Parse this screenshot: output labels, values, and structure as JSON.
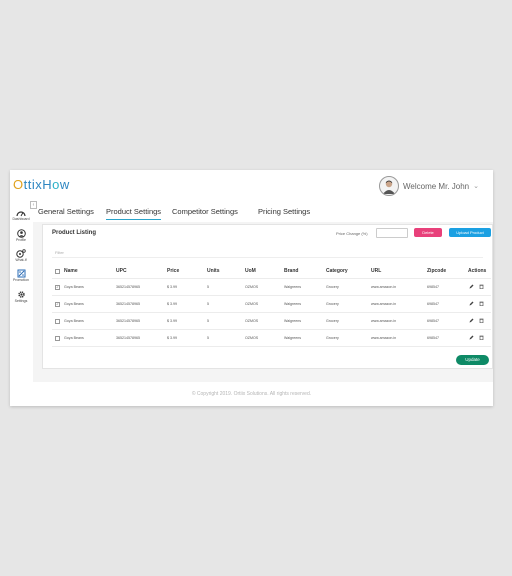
{
  "app": {
    "logo": {
      "part1": "O",
      "part2": "ttixH",
      "part3": "o",
      "part4": "w"
    },
    "welcome": "Welcome Mr. John"
  },
  "sidebar": {
    "items": [
      {
        "label": "Dashboard",
        "icon": "dashboard-icon"
      },
      {
        "label": "Profile",
        "icon": "profile-icon"
      },
      {
        "label": "What-If",
        "icon": "what-if-icon"
      },
      {
        "label": "Promotion",
        "icon": "promotion-icon"
      },
      {
        "label": "Settings",
        "icon": "settings-icon"
      }
    ]
  },
  "tabs": [
    {
      "label": "General Settings"
    },
    {
      "label": "Product Settings",
      "active": true
    },
    {
      "label": "Competitor Settings"
    },
    {
      "label": "Pricing Settings"
    }
  ],
  "panel": {
    "title": "Product Listing",
    "price_change_label": "Price Change (%)",
    "price_change_value": "",
    "delete_label": "Delete",
    "upload_label": "Upload Product",
    "filter_label": "Filter",
    "update_label": "Update"
  },
  "table": {
    "columns": [
      "Name",
      "UPC",
      "Price",
      "Units",
      "UoM",
      "Brand",
      "Category",
      "URL",
      "Zipcode",
      "Actions"
    ],
    "rows": [
      {
        "checked": true,
        "name": "Goya Beans",
        "upc": "365214578965",
        "price": "$ 3.99",
        "units": "5",
        "uom": "OZMOS",
        "brand": "Walgreens",
        "category": "Grocery",
        "url": "www.amazon.in",
        "zipcode": "698547"
      },
      {
        "checked": true,
        "name": "Goya Beans",
        "upc": "365214578965",
        "price": "$ 3.99",
        "units": "5",
        "uom": "OZMOS",
        "brand": "Walgreens",
        "category": "Grocery",
        "url": "www.amazon.in",
        "zipcode": "698547"
      },
      {
        "checked": false,
        "name": "Goya Beans",
        "upc": "365214578965",
        "price": "$ 3.99",
        "units": "5",
        "uom": "OZMOS",
        "brand": "Walgreens",
        "category": "Grocery",
        "url": "www.amazon.in",
        "zipcode": "698547"
      },
      {
        "checked": false,
        "name": "Goya Beans",
        "upc": "365214578965",
        "price": "$ 3.99",
        "units": "5",
        "uom": "OZMOS",
        "brand": "Walgreens",
        "category": "Grocery",
        "url": "www.amazon.in",
        "zipcode": "698547"
      }
    ]
  },
  "footer": {
    "text": "© Copyright 2019. Ortiix Solutions. All rights reserved."
  },
  "colors": {
    "accent": "#29a3c9",
    "delete": "#e8407a",
    "upload": "#1ba0e2",
    "update": "#0e8a66"
  }
}
